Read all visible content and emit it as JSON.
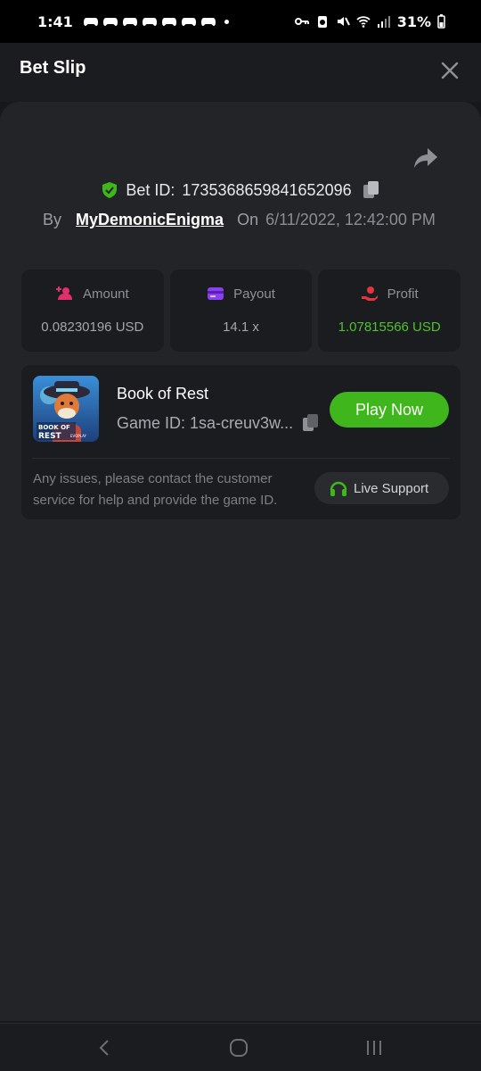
{
  "status_bar": {
    "time": "1:41",
    "battery": "31%"
  },
  "header": {
    "title": "Bet Slip"
  },
  "bet": {
    "id_label": "Bet ID:",
    "id_value": "1735368659841652096",
    "by_label": "By",
    "username": "MyDemonicEnigma",
    "on_label": "On",
    "date": "6/11/2022, 12:42:00 PM"
  },
  "stats": [
    {
      "label": "Amount",
      "value": "0.08230196 USD",
      "icon": "amount-icon",
      "color": "#e0306c"
    },
    {
      "label": "Payout",
      "value": "14.1 x",
      "icon": "card-icon",
      "color": "#8a3ff0"
    },
    {
      "label": "Profit",
      "value": "1.07815566 USD",
      "icon": "profit-hand-icon",
      "color": "#e3343f"
    }
  ],
  "game": {
    "name": "Book of Rest",
    "game_id": "Game ID: 1sa-creuv3w...",
    "play_label": "Play Now",
    "thumb_text_top": "BOOK OF",
    "thumb_text_bottom": "REST",
    "thumb_brand": "EVOPLAY"
  },
  "support": {
    "issue_text": "Any issues, please contact the customer service for help and provide the game ID.",
    "button_label": "Live Support"
  },
  "colors": {
    "accent_green": "#3fb61c",
    "profit_green": "#4fc22c"
  }
}
